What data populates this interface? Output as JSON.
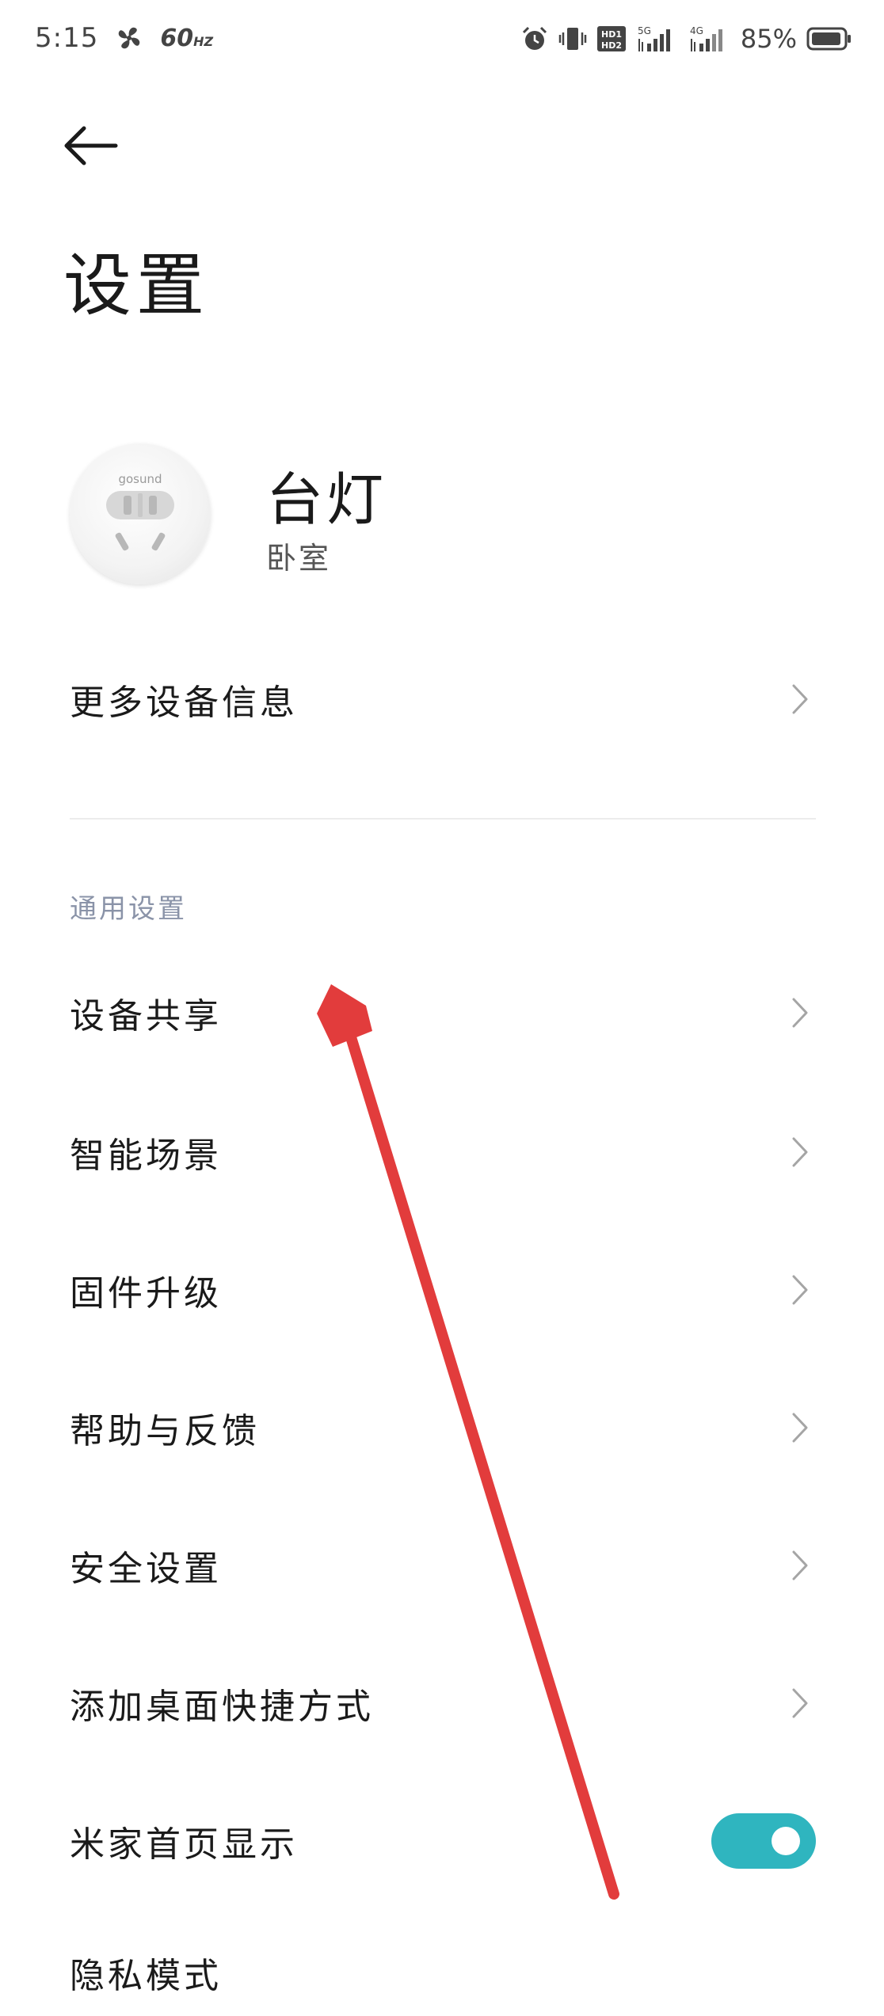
{
  "status_bar": {
    "time": "5:15",
    "refresh_rate": "60",
    "refresh_unit": "HZ",
    "battery_percent": "85%",
    "icons": [
      "fan-icon",
      "alarm-icon",
      "vibrate-icon",
      "hd-icon",
      "signal-5g-icon",
      "signal-4g-icon",
      "battery-icon"
    ]
  },
  "header": {
    "title": "设置"
  },
  "device": {
    "name": "台灯",
    "room": "卧室",
    "brand_mark": "gosund"
  },
  "more_info": {
    "label": "更多设备信息"
  },
  "general_section": {
    "header": "通用设置",
    "items": [
      {
        "label": "设备共享"
      },
      {
        "label": "智能场景"
      },
      {
        "label": "固件升级"
      },
      {
        "label": "帮助与反馈"
      },
      {
        "label": "安全设置"
      },
      {
        "label": "添加桌面快捷方式"
      }
    ],
    "toggle_item": {
      "label": "米家首页显示",
      "enabled": true
    },
    "partial_item": {
      "label": "隐私模式"
    }
  },
  "colors": {
    "accent": "#2fb5bf",
    "annotation_arrow": "#e23c3c",
    "section_header": "#8a93a8"
  }
}
